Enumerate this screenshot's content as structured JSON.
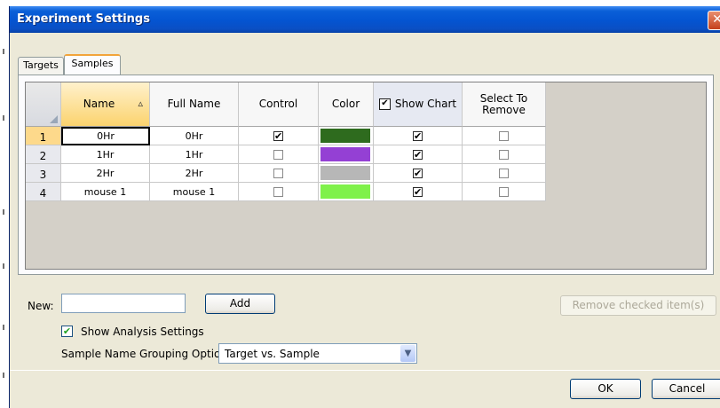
{
  "window": {
    "title": "Experiment Settings",
    "close_glyph": "✕"
  },
  "tabs": [
    {
      "label": "Targets",
      "selected": false
    },
    {
      "label": "Samples",
      "selected": true
    }
  ],
  "grid": {
    "columns": [
      "Name",
      "Full Name",
      "Control",
      "Color",
      "Show Chart",
      "Select To Remove"
    ],
    "sort_arrow": "▵",
    "show_chart_header_checked": "✔",
    "rows": [
      {
        "num": "1",
        "name": "0Hr",
        "full_name": "0Hr",
        "control": true,
        "color": "#2e6b1e",
        "show_chart": true,
        "remove": false
      },
      {
        "num": "2",
        "name": "1Hr",
        "full_name": "1Hr",
        "control": false,
        "color": "#9440d4",
        "show_chart": true,
        "remove": false
      },
      {
        "num": "3",
        "name": "2Hr",
        "full_name": "2Hr",
        "control": false,
        "color": "#b7b7b7",
        "show_chart": true,
        "remove": false
      },
      {
        "num": "4",
        "name": "mouse 1",
        "full_name": "mouse 1",
        "control": false,
        "color": "#7ff14a",
        "show_chart": true,
        "remove": false
      }
    ],
    "check_glyph": "✔"
  },
  "new_row": {
    "label": "New:",
    "value": "",
    "add_label": "Add"
  },
  "remove_label": "Remove checked item(s)",
  "analysis": {
    "label": "Show Analysis Settings",
    "checked": "✔"
  },
  "grouping": {
    "label": "Sample Name Grouping Option:",
    "value": "Target vs. Sample",
    "arrow": "▼"
  },
  "buttons": {
    "ok": "OK",
    "cancel": "Cancel"
  },
  "colors": {
    "title_bar": "#0454d1",
    "active_tab": "#f2a43a",
    "row_active": "#fdd98b",
    "sorted_header": "#fbd36e"
  }
}
